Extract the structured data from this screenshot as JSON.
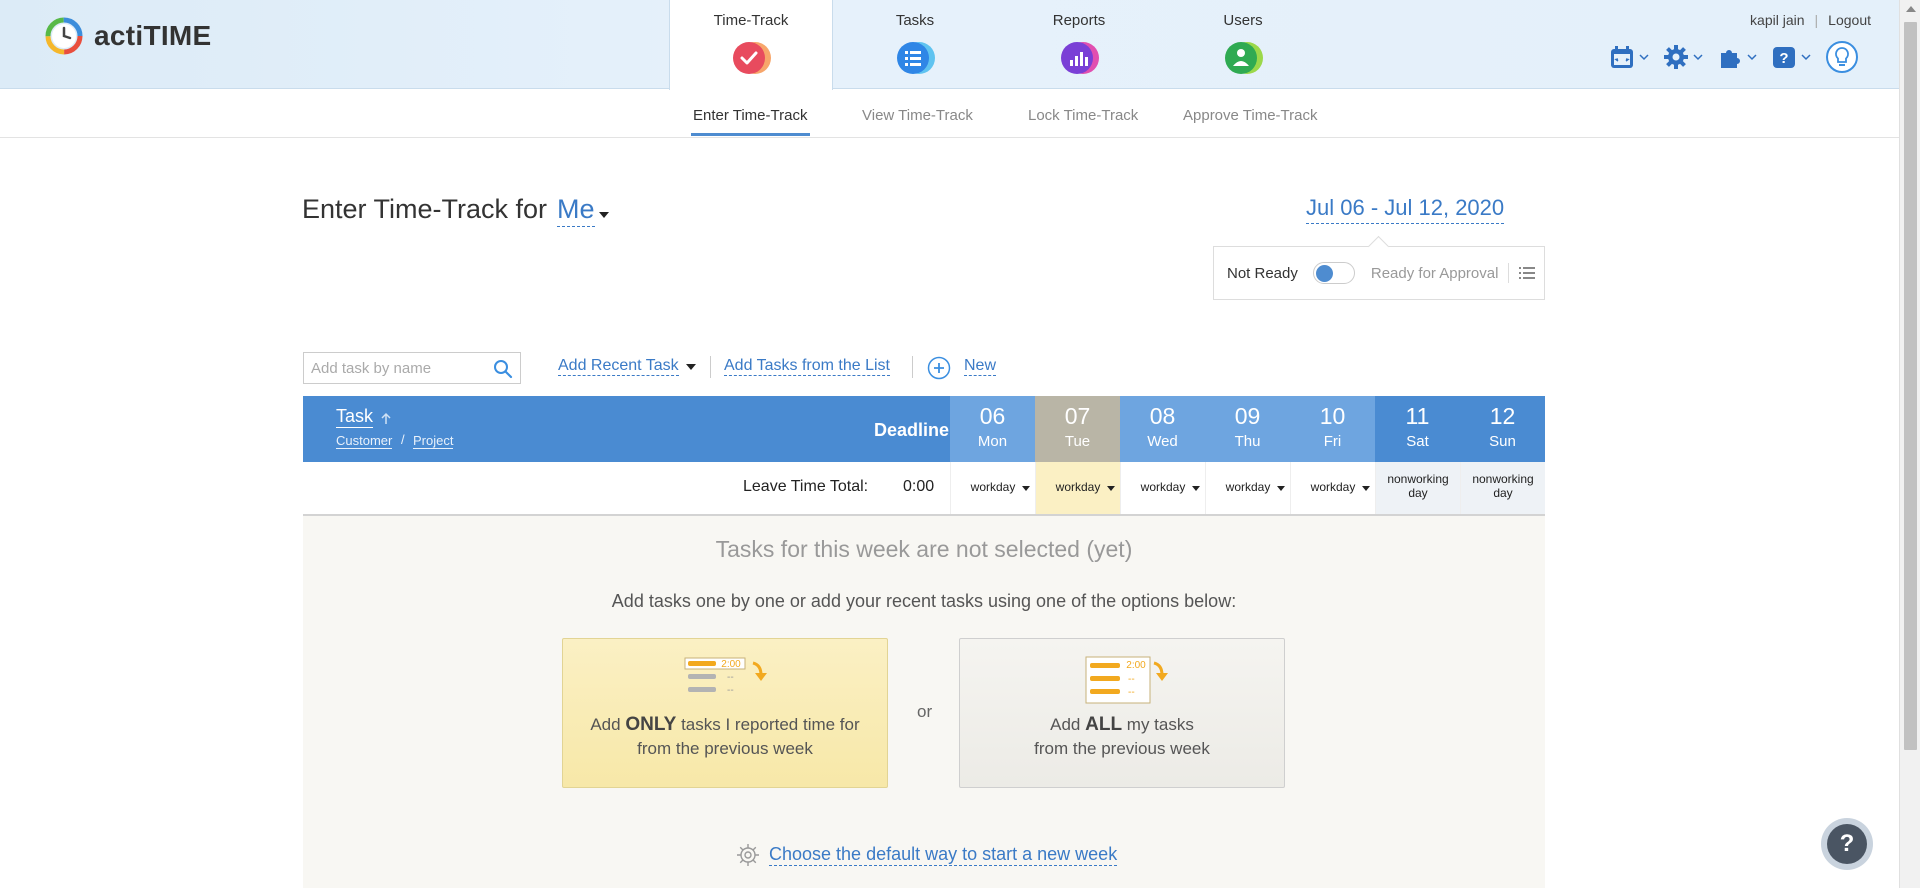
{
  "app": {
    "logo_text": "actiTIME"
  },
  "nav": {
    "tabs": [
      {
        "label": "Time-Track",
        "icon": "time-track-check-icon",
        "active": true
      },
      {
        "label": "Tasks",
        "icon": "tasks-list-icon"
      },
      {
        "label": "Reports",
        "icon": "reports-chart-icon"
      },
      {
        "label": "Users",
        "icon": "users-person-icon"
      }
    ]
  },
  "user": {
    "name": "kapil jain",
    "separator": "|",
    "logout_label": "Logout"
  },
  "toolbar_icons": [
    "calendar-icon",
    "gear-icon",
    "puzzle-icon",
    "help-icon",
    "lightbulb-icon"
  ],
  "subnav": {
    "items": [
      {
        "label": "Enter Time-Track",
        "active": true
      },
      {
        "label": "View Time-Track"
      },
      {
        "label": "Lock Time-Track"
      },
      {
        "label": "Approve Time-Track"
      }
    ]
  },
  "page": {
    "title_prefix": "Enter Time-Track for",
    "who": "Me",
    "date_range": "Jul 06 - Jul 12, 2020"
  },
  "approval": {
    "not_ready": "Not Ready",
    "ready": "Ready for Approval",
    "toggle_on": false
  },
  "add_task": {
    "search_placeholder": "Add task by name",
    "recent_label": "Add Recent Task",
    "from_list_label": "Add Tasks from the List",
    "new_label": "New"
  },
  "table": {
    "task_header": "Task",
    "customer_label": "Customer",
    "slash": "/",
    "project_label": "Project",
    "deadline_label": "Deadline",
    "days": [
      {
        "num": "06",
        "dow": "Mon",
        "bg": "#6ea5e0"
      },
      {
        "num": "07",
        "dow": "Tue",
        "bg": "#b9b5a6"
      },
      {
        "num": "08",
        "dow": "Wed",
        "bg": "#6ea5e0"
      },
      {
        "num": "09",
        "dow": "Thu",
        "bg": "#6ea5e0"
      },
      {
        "num": "10",
        "dow": "Fri",
        "bg": "#6ea5e0"
      },
      {
        "num": "11",
        "dow": "Sat",
        "bg": "#4a8bd2"
      },
      {
        "num": "12",
        "dow": "Sun",
        "bg": "#4a8bd2"
      }
    ],
    "leave_label": "Leave Time Total:",
    "leave_value": "0:00",
    "leave_cells": [
      {
        "text": "workday",
        "dropdown": true,
        "bg": "#ffffff"
      },
      {
        "text": "workday",
        "dropdown": true,
        "bg": "#fbf0c4"
      },
      {
        "text": "workday",
        "dropdown": true,
        "bg": "#ffffff"
      },
      {
        "text": "workday",
        "dropdown": true,
        "bg": "#ffffff"
      },
      {
        "text": "workday",
        "dropdown": true,
        "bg": "#ffffff"
      },
      {
        "text": "nonworking day",
        "dropdown": false,
        "bg": "#eef2f6"
      },
      {
        "text": "nonworking day",
        "dropdown": false,
        "bg": "#eef2f6"
      }
    ]
  },
  "empty_state": {
    "title": "Tasks for this week are not selected (yet)",
    "subtitle": "Add tasks one by one or add your recent tasks using one of the options below:",
    "only_card": {
      "pre": "Add ",
      "emph": "ONLY",
      "post": " tasks I reported time for",
      "line2": "from the previous week",
      "illu_time": "2:00",
      "illu_dash": "--"
    },
    "or_label": "or",
    "all_card": {
      "pre": "Add ",
      "emph": "ALL",
      "post": " my tasks",
      "line2": "from the previous week",
      "illu_time": "2:00",
      "illu_dash": "--"
    },
    "default_link": "Choose the default way to start a new week"
  },
  "help_label": "?",
  "colors": {
    "accent": "#4a8bd2",
    "link": "#3a7ac6",
    "highlight_day": "#fbf0c4"
  }
}
